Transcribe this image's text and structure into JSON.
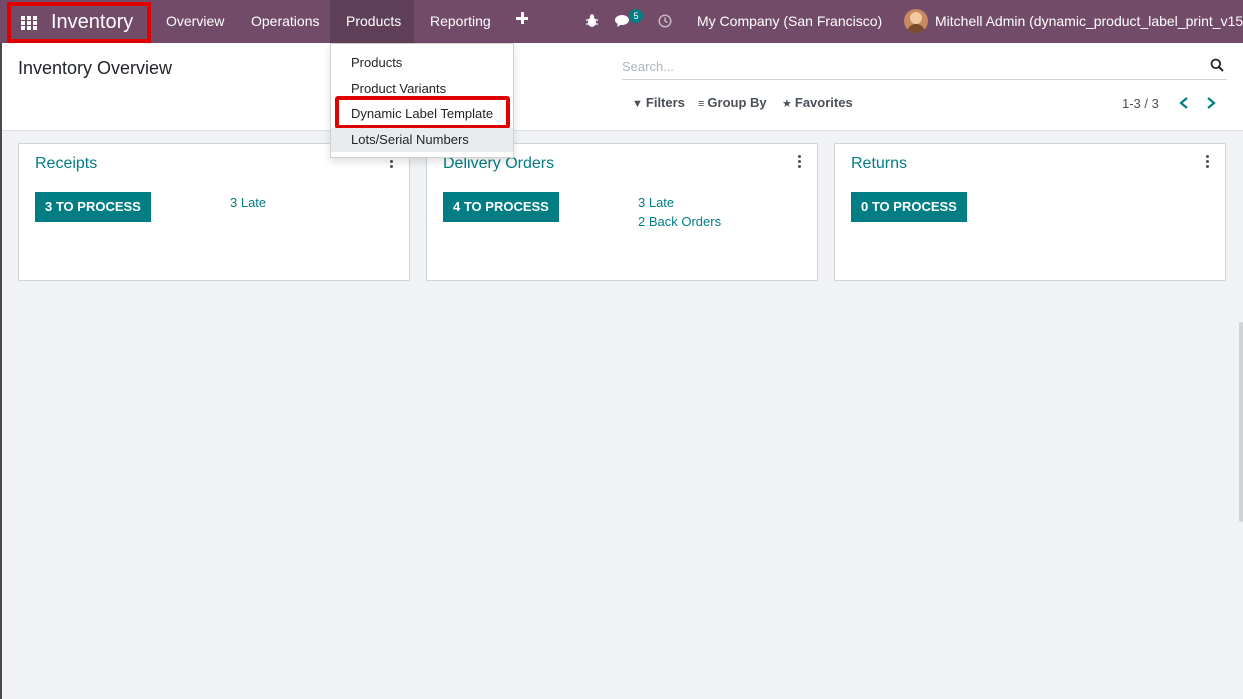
{
  "navbar": {
    "app_title": "Inventory",
    "menu": [
      "Overview",
      "Operations",
      "Products",
      "Reporting"
    ],
    "active_menu": "Products",
    "message_count": "5",
    "company": "My Company (San Francisco)",
    "user": "Mitchell Admin (dynamic_product_label_print_v15)",
    "icons": [
      "apps-icon",
      "plus-icon",
      "bug-icon",
      "chat-icon",
      "clock-icon"
    ],
    "color": "#714b67"
  },
  "control_panel": {
    "title": "Inventory Overview",
    "search_placeholder": "Search...",
    "filters_label": "Filters",
    "groupby_label": "Group By",
    "favorites_label": "Favorites",
    "pager": "1-3 / 3"
  },
  "products_dropdown": {
    "items": [
      "Products",
      "Product Variants",
      "Dynamic Label Template",
      "Lots/Serial Numbers"
    ],
    "highlighted": "Dynamic Label Template",
    "hovered": "Lots/Serial Numbers"
  },
  "cards": [
    {
      "title": "Receipts",
      "button": "3 TO PROCESS",
      "links": [
        "3 Late"
      ]
    },
    {
      "title": "Delivery Orders",
      "button": "4 TO PROCESS",
      "links": [
        "3 Late",
        "2 Back Orders"
      ]
    },
    {
      "title": "Returns",
      "button": "0 TO PROCESS",
      "links": []
    }
  ],
  "colors": {
    "accent": "#017e84",
    "highlight": "#e00000"
  }
}
